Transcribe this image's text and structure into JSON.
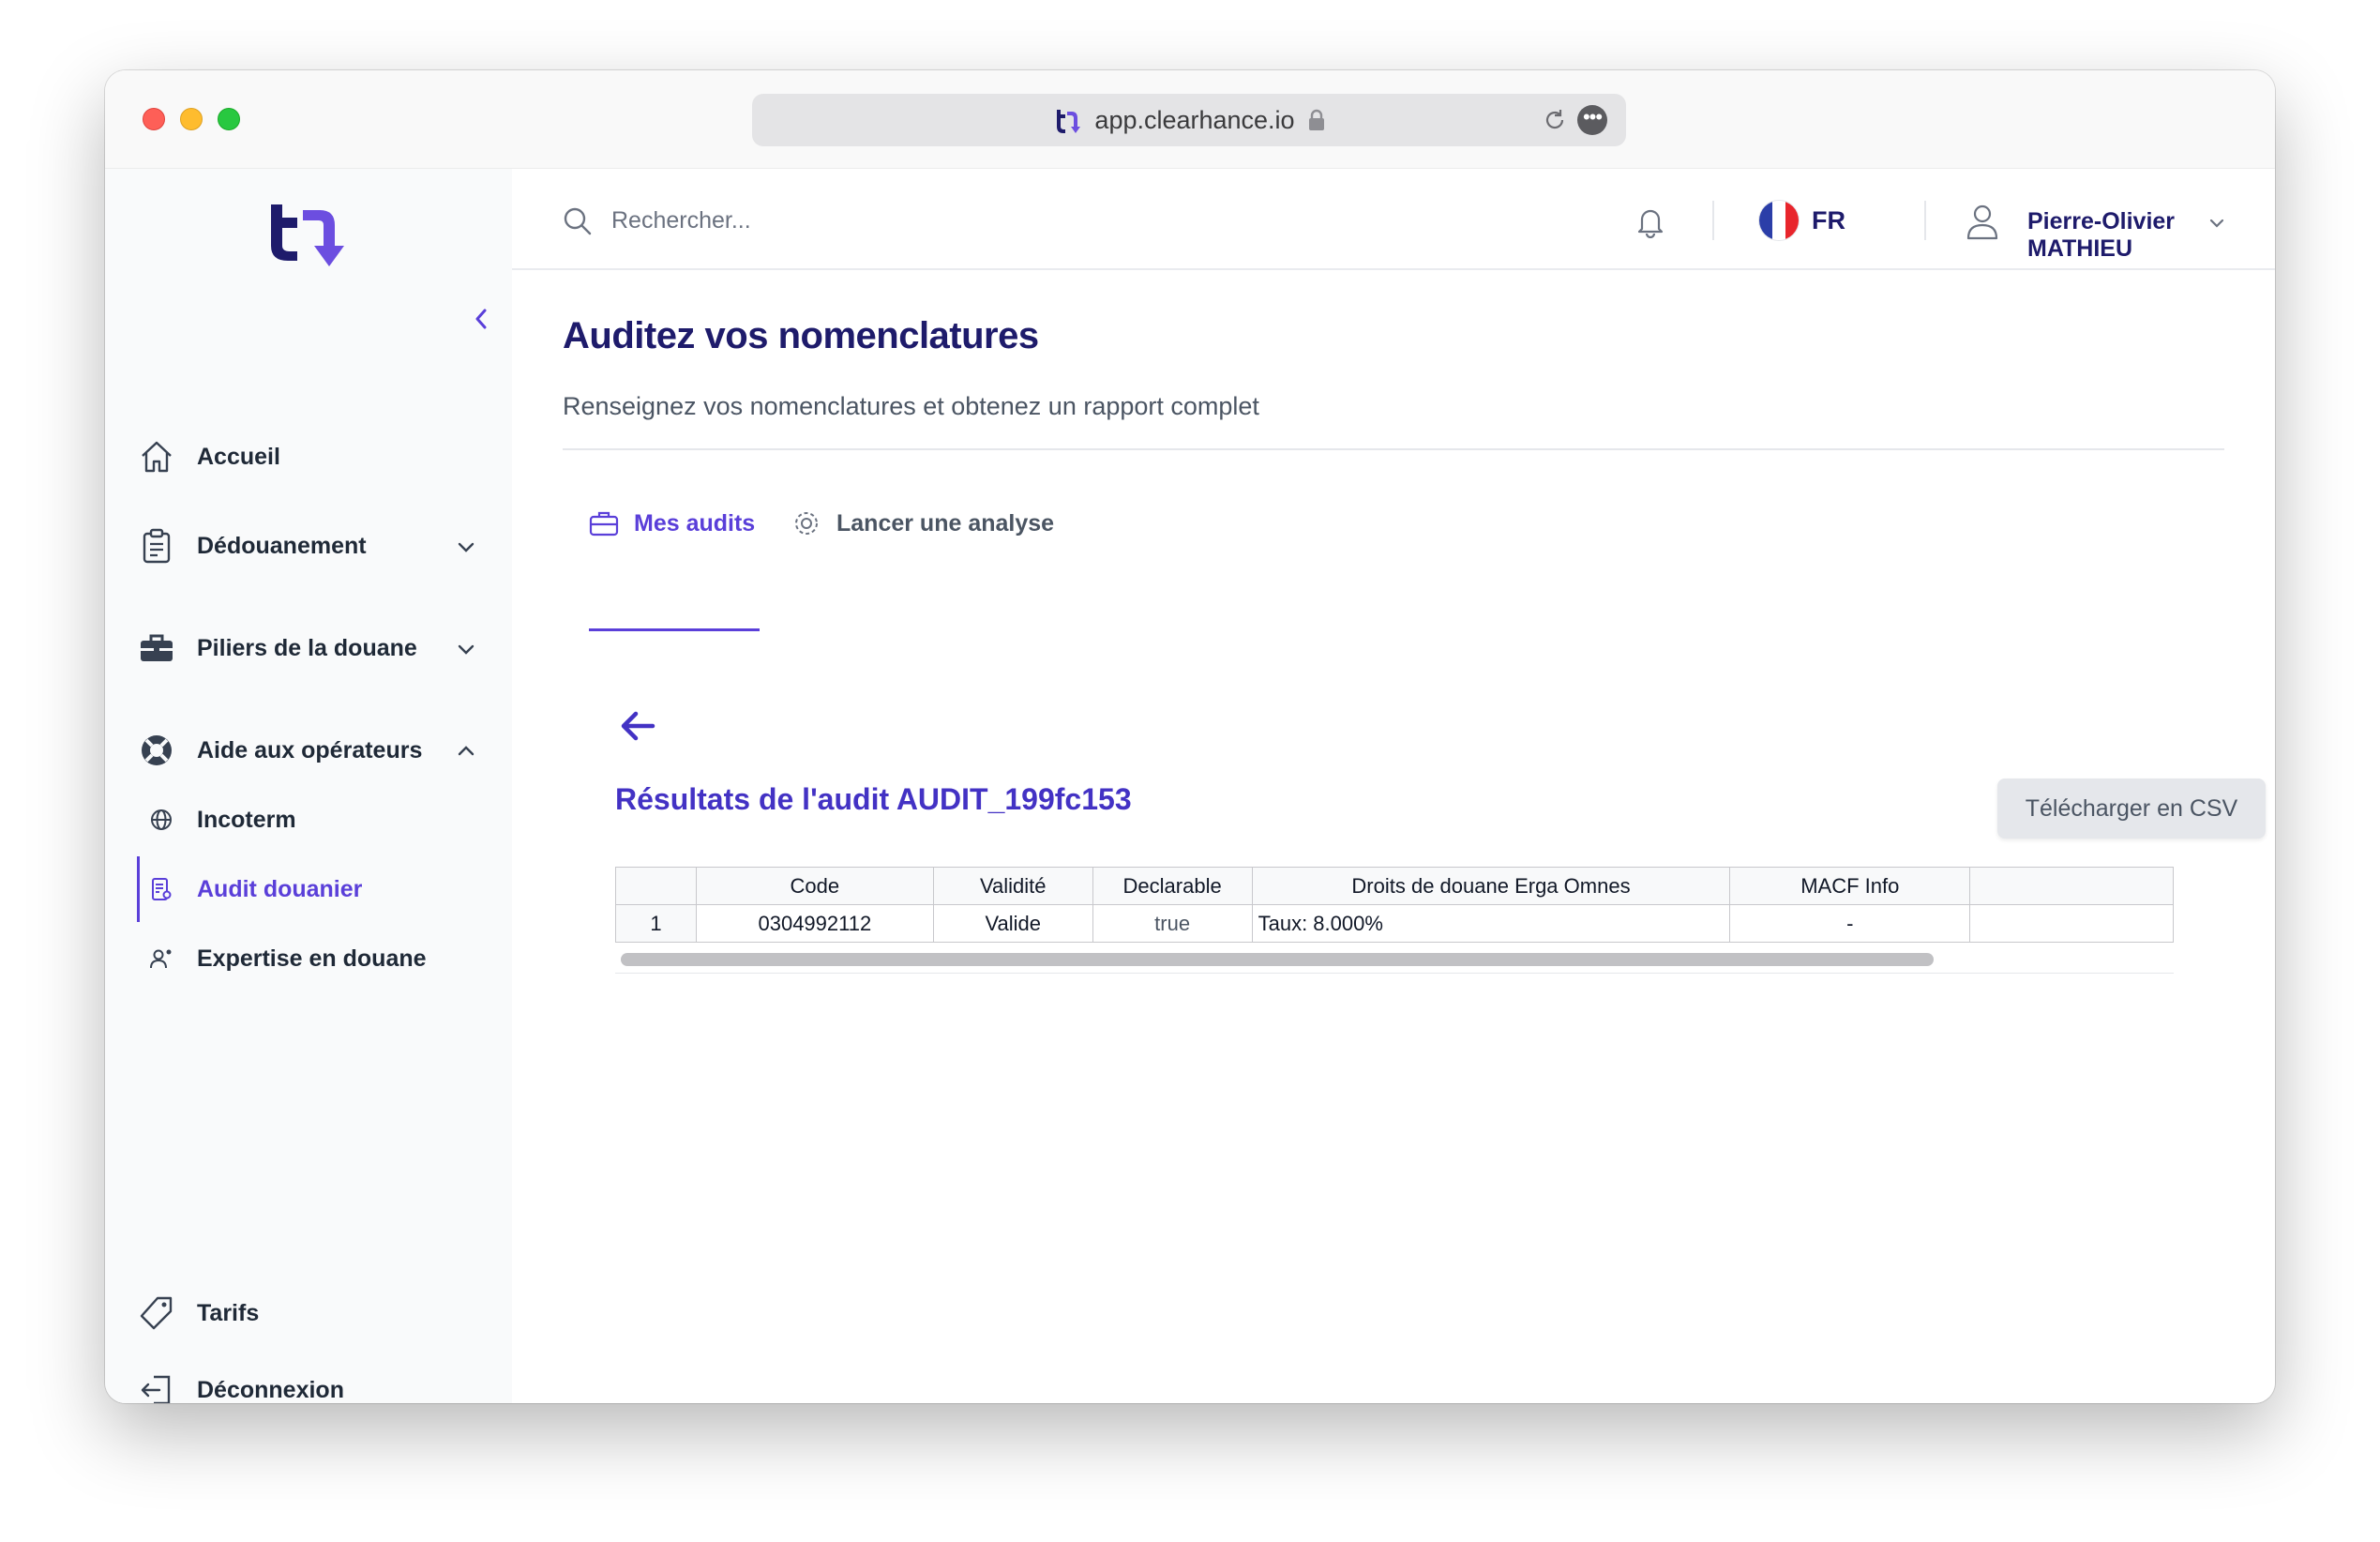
{
  "browser": {
    "url": "app.clearhance.io"
  },
  "sidebar": {
    "items": [
      {
        "label": "Accueil"
      },
      {
        "label": "Dédouanement"
      },
      {
        "label": "Piliers de la douane"
      },
      {
        "label": "Aide aux opérateurs"
      }
    ],
    "subitems": [
      {
        "label": "Incoterm"
      },
      {
        "label": "Audit douanier"
      },
      {
        "label": "Expertise en douane"
      }
    ],
    "bottom": [
      {
        "label": "Tarifs"
      },
      {
        "label": "Déconnexion"
      }
    ]
  },
  "topbar": {
    "search_placeholder": "Rechercher...",
    "language": "FR",
    "user_name": "Pierre-Olivier MATHIEU"
  },
  "page": {
    "title": "Auditez vos nomenclatures",
    "subtitle": "Renseignez vos nomenclatures et obtenez un rapport complet",
    "tabs": [
      {
        "label": "Mes audits"
      },
      {
        "label": "Lancer une analyse"
      }
    ],
    "results_title": "Résultats de l'audit AUDIT_199fc153",
    "download_label": "Télécharger en CSV"
  },
  "table": {
    "headers": [
      "",
      "Code",
      "Validité",
      "Declarable",
      "Droits de douane Erga Omnes",
      "MACF Info",
      ""
    ],
    "rows": [
      [
        "1",
        "0304992112",
        "Valide",
        "true",
        "Taux: 8.000%",
        "-",
        ""
      ]
    ]
  },
  "colors": {
    "accent": "#5a3fd9",
    "title": "#1e1b6b"
  }
}
